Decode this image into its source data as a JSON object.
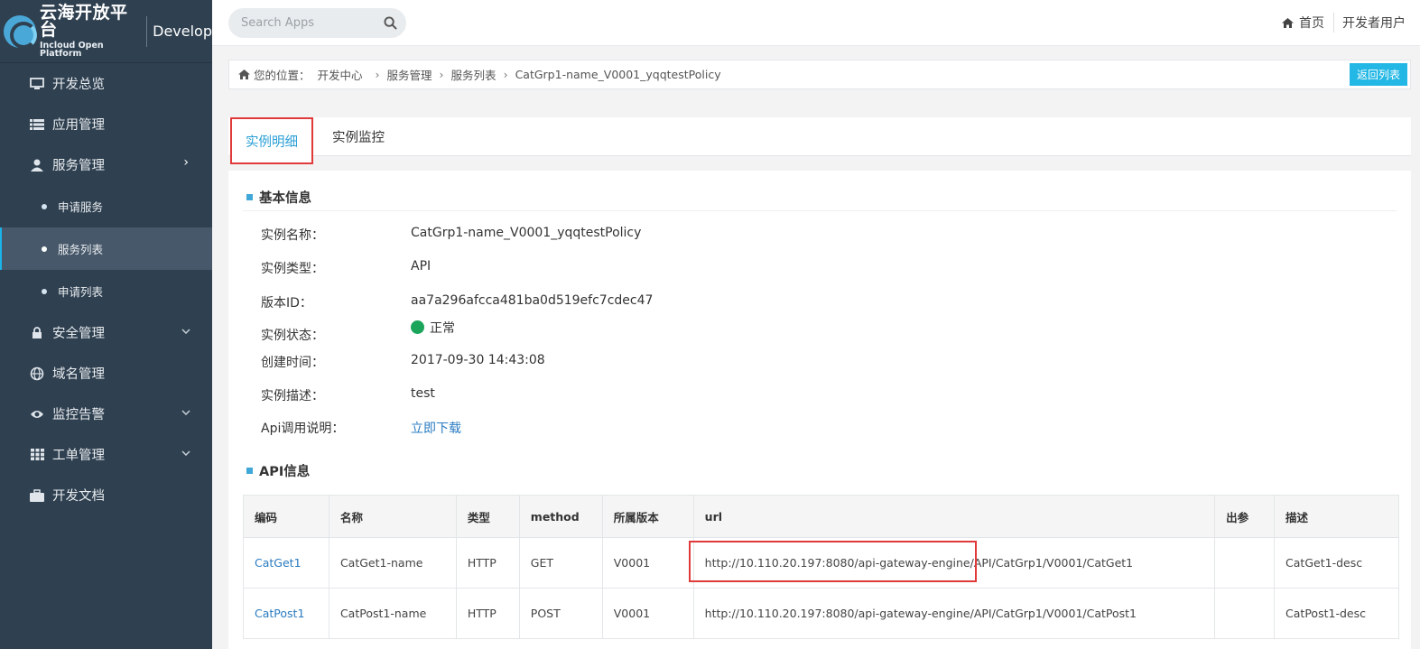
{
  "brand": {
    "name_cn": "云海开放平台",
    "name_en": "Incloud Open Platform",
    "section": "Develop"
  },
  "search": {
    "placeholder": "Search Apps"
  },
  "top_nav": {
    "home": "首页",
    "user": "开发者用户"
  },
  "sidebar": {
    "items": [
      {
        "label": "开发总览",
        "icon": "monitor-icon"
      },
      {
        "label": "应用管理",
        "icon": "list-icon"
      },
      {
        "label": "服务管理",
        "icon": "user-icon",
        "expanded": true
      },
      {
        "label": "安全管理",
        "icon": "lock-icon"
      },
      {
        "label": "域名管理",
        "icon": "globe-icon"
      },
      {
        "label": "监控告警",
        "icon": "eye-icon"
      },
      {
        "label": "工单管理",
        "icon": "grid-icon"
      },
      {
        "label": "开发文档",
        "icon": "briefcase-icon"
      }
    ],
    "sub_items": [
      {
        "label": "申请服务"
      },
      {
        "label": "服务列表",
        "active": true
      },
      {
        "label": "申请列表"
      }
    ]
  },
  "breadcrumb": {
    "prefix": "您的位置：",
    "items": [
      "开发中心",
      "服务管理",
      "服务列表",
      "CatGrp1-name_V0001_yqqtestPolicy"
    ],
    "back_button": "返回列表"
  },
  "tabs": [
    {
      "label": "实例明细",
      "active": true
    },
    {
      "label": "实例监控"
    }
  ],
  "basic_info": {
    "title": "基本信息",
    "name_label": "实例名称：",
    "name_value": "CatGrp1-name_V0001_yqqtestPolicy",
    "type_label": "实例类型：",
    "type_value": "API",
    "version_label": "版本ID：",
    "version_value": "aa7a296afcca481ba0d519efc7cdec47",
    "status_label": "实例状态：",
    "status_value": "正常",
    "status_color": "#1aa55a",
    "created_label": "创建时间：",
    "created_value": "2017-09-30 14:43:08",
    "desc_label": "实例描述：",
    "desc_value": "test",
    "api_doc_label": "Api调用说明：",
    "api_doc_link": "立即下载"
  },
  "api_info": {
    "title": "API信息",
    "columns": [
      "编码",
      "名称",
      "类型",
      "method",
      "所属版本",
      "url",
      "出参",
      "描述"
    ],
    "rows": [
      {
        "code": "CatGet1",
        "name": "CatGet1-name",
        "type": "HTTP",
        "method": "GET",
        "version": "V0001",
        "url": "http://10.110.20.197:8080/api-gateway-engine/API/CatGrp1/V0001/CatGet1",
        "output": "",
        "desc": "CatGet1-desc"
      },
      {
        "code": "CatPost1",
        "name": "CatPost1-name",
        "type": "HTTP",
        "method": "POST",
        "version": "V0001",
        "url": "http://10.110.20.197:8080/api-gateway-engine/API/CatGrp1/V0001/CatPost1",
        "output": "",
        "desc": "CatPost1-desc"
      }
    ]
  },
  "colors": {
    "sidebar_bg": "#2f4050",
    "accent": "#23b7e5",
    "highlight_box": "#e03a3a",
    "link": "#2a7bc0"
  }
}
